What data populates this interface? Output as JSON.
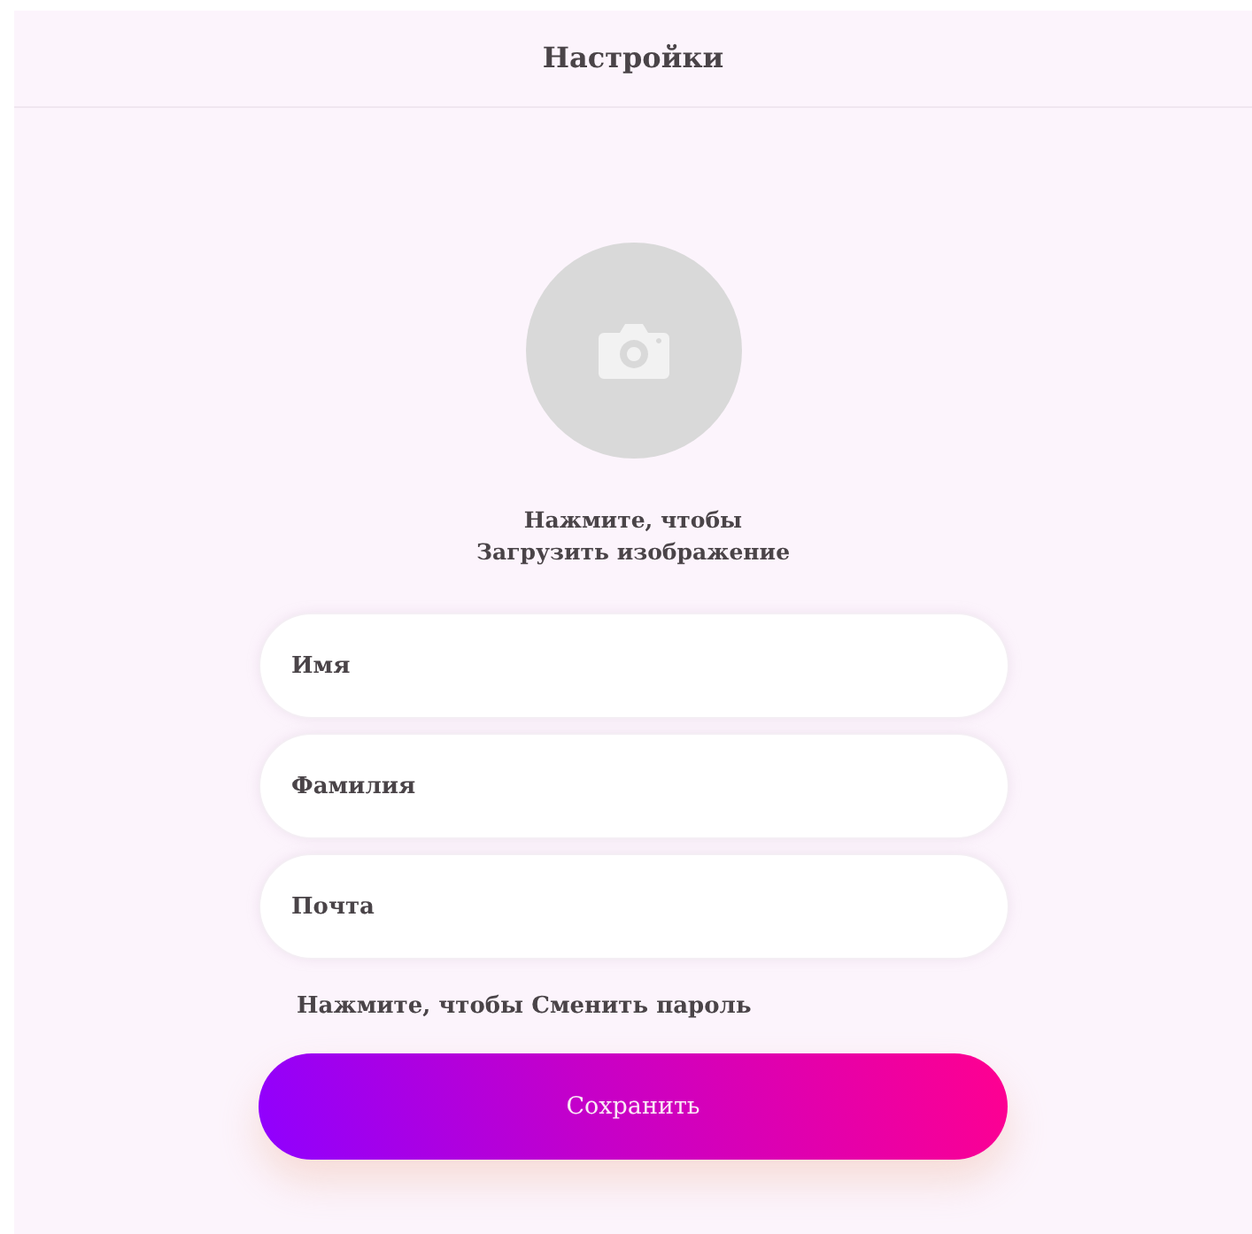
{
  "header": {
    "title": "Настройки"
  },
  "avatar": {
    "hint_line_1": "Нажмите, чтобы",
    "hint_line_2": "Загрузить изображение"
  },
  "fields": [
    {
      "placeholder": "Имя"
    },
    {
      "placeholder": "Фамилия"
    },
    {
      "placeholder": "Почта"
    }
  ],
  "change_password_link": "Нажмите, чтобы Сменить пароль",
  "save_button": "Сохранить"
}
